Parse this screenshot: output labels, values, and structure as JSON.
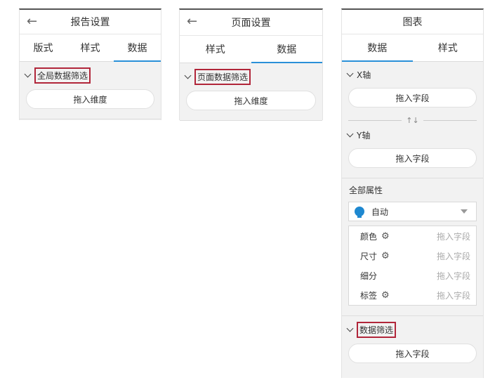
{
  "panel1": {
    "title": "报告设置",
    "tabs": [
      "版式",
      "样式",
      "数据"
    ],
    "section": "全局数据筛选",
    "drop_label": "拖入维度"
  },
  "panel2": {
    "title": "页面设置",
    "tabs": [
      "样式",
      "数据"
    ],
    "section": "页面数据筛选",
    "drop_label": "拖入维度"
  },
  "panel3": {
    "title": "图表",
    "tabs": [
      "数据",
      "样式"
    ],
    "x_axis": "X轴",
    "y_axis": "Y轴",
    "drop_label": "拖入字段",
    "swap_symbol": "↑↓",
    "all_props": "全部属性",
    "select_value": "自动",
    "attrs": [
      {
        "label": "颜色",
        "placeholder": "拖入字段"
      },
      {
        "label": "尺寸",
        "placeholder": "拖入字段"
      },
      {
        "label": "细分",
        "placeholder": "拖入字段"
      },
      {
        "label": "标签",
        "placeholder": "拖入字段"
      }
    ],
    "filter_section": "数据筛选"
  },
  "colors": {
    "accent": "#2a90d8",
    "highlight": "#b1263a"
  }
}
